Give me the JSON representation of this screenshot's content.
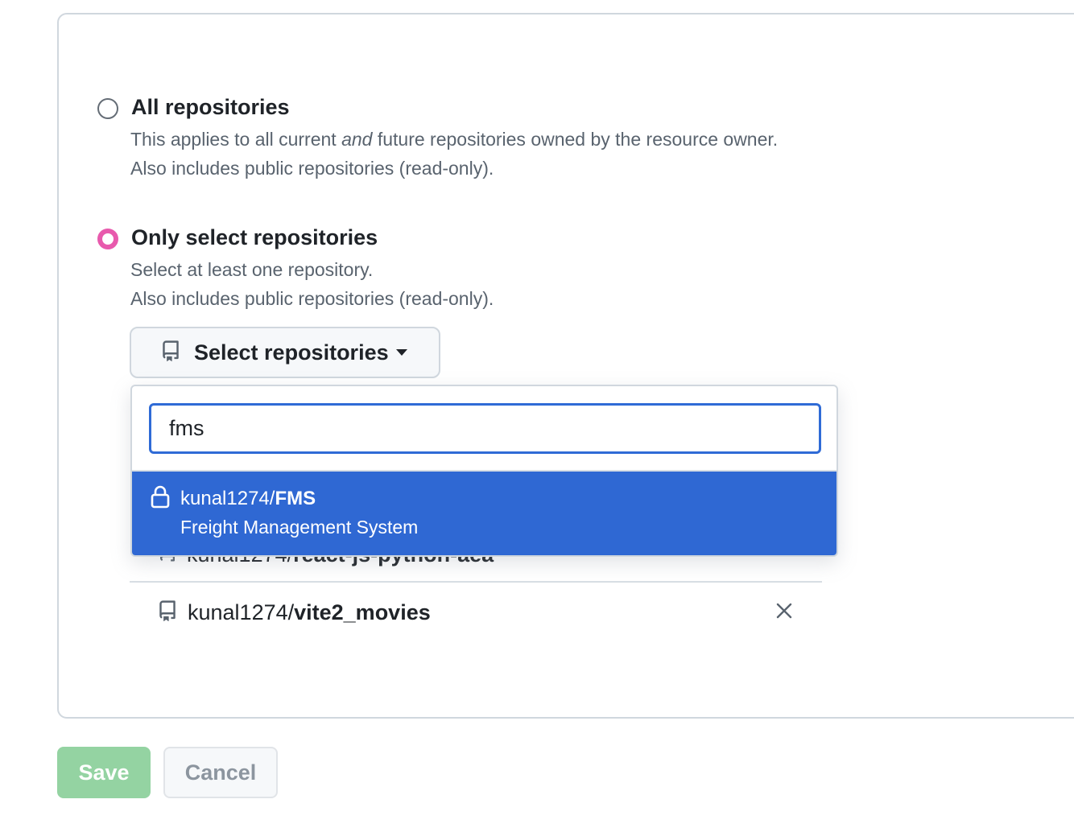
{
  "options": {
    "all": {
      "title": "All repositories",
      "desc_before": "This applies to all current ",
      "desc_em": "and",
      "desc_after": " future repositories owned by the resource owner.",
      "desc_line2": "Also includes public repositories (read-only).",
      "selected": false
    },
    "select": {
      "title": "Only select repositories",
      "desc_line1": "Select at least one repository.",
      "desc_line2": "Also includes public repositories (read-only).",
      "selected": true
    }
  },
  "select_button": {
    "label": "Select repositories",
    "icon": "repo-icon"
  },
  "dropdown": {
    "search_value": "fms",
    "results": [
      {
        "owner": "kunal1274/",
        "name": "FMS",
        "description": "Freight Management System",
        "icon": "lock-icon",
        "highlighted": true
      }
    ]
  },
  "selected_repos": [
    {
      "owner": "kunal1274/",
      "name": "react-js-python-aea"
    },
    {
      "owner": "kunal1274/",
      "name": "vite2_movies"
    }
  ],
  "actions": {
    "save_label": "Save",
    "cancel_label": "Cancel"
  },
  "colors": {
    "accent_radio": "#e85aad",
    "focus_blue": "#2f6bd6",
    "highlight_blue": "#2f68d3",
    "save_disabled": "#94d3a2"
  }
}
